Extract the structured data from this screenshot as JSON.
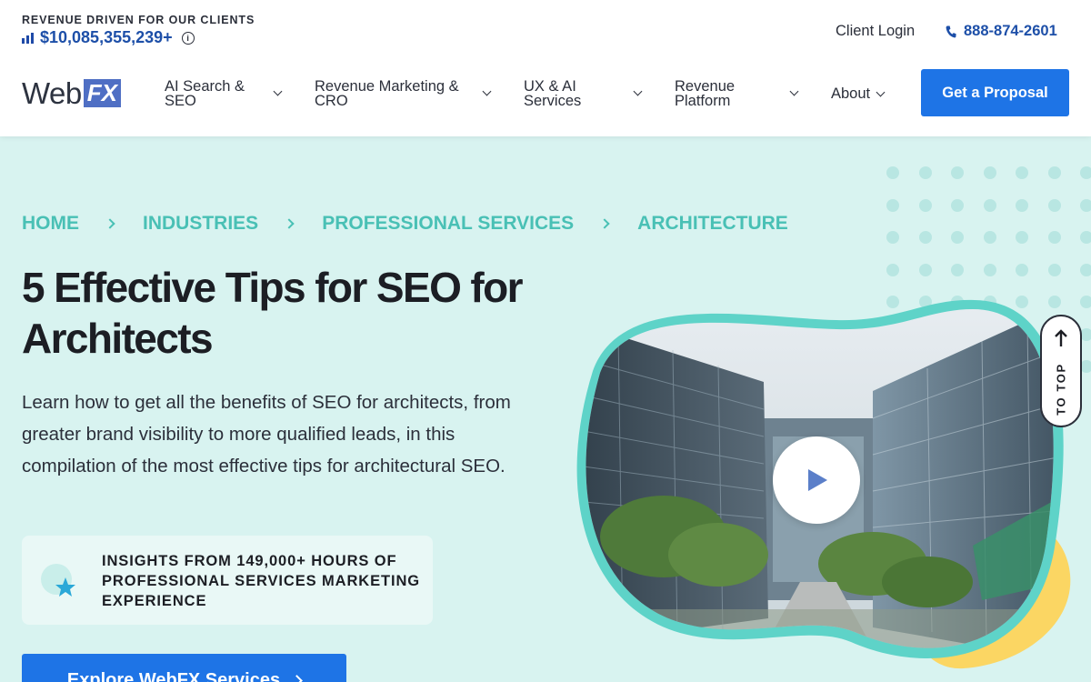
{
  "header": {
    "revenue_label": "REVENUE DRIVEN FOR OUR CLIENTS",
    "revenue_value": "$10,085,355,239+",
    "client_login": "Client Login",
    "phone": "888-874-2601",
    "logo": {
      "web": "Web",
      "fx": "FX"
    },
    "nav": [
      {
        "line1": "AI Search &",
        "line2": "SEO"
      },
      {
        "line1": "Revenue Marketing &",
        "line2": "CRO"
      },
      {
        "line1": "UX & AI",
        "line2": "Services"
      },
      {
        "line1": "Revenue",
        "line2": "Platform"
      },
      {
        "line1": "About",
        "line2": ""
      }
    ],
    "cta": "Get a Proposal"
  },
  "hero": {
    "breadcrumb": [
      "HOME",
      "INDUSTRIES",
      "PROFESSIONAL SERVICES",
      "ARCHITECTURE"
    ],
    "title": "5 Effective Tips for SEO for Architects",
    "description": "Learn how to get all the benefits of SEO for architects, from greater brand visibility to more qualified leads, in this compilation of the most effective tips for architectural SEO.",
    "insight": "INSIGHTS FROM 149,000+ HOURS OF PROFESSIONAL SERVICES MARKETING EXPERIENCE",
    "explore_button": "Explore WebFX Services",
    "to_top": "TO TOP"
  },
  "colors": {
    "brand_blue": "#1e74e6",
    "teal": "#49c0b5",
    "hero_bg": "#d8f3f0",
    "accent_yellow": "#fbd663"
  }
}
